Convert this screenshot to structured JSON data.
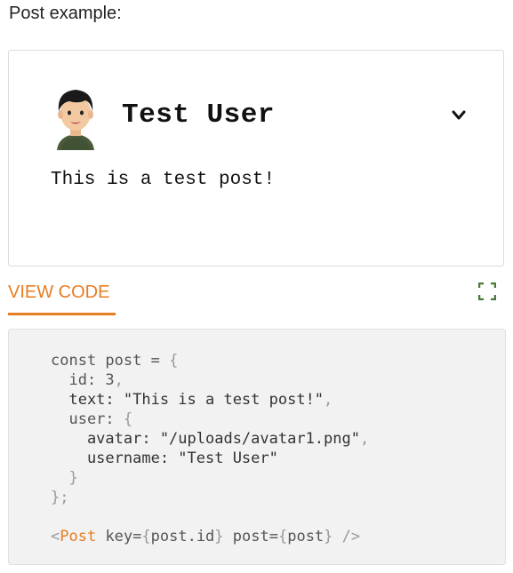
{
  "heading": "Post example:",
  "post": {
    "username": "Test User",
    "text": "This is a test post!",
    "avatar_icon": "avatar-boy-icon",
    "menu_icon": "chevron-down-icon"
  },
  "tabs": [
    {
      "label": "VIEW CODE",
      "active": true
    }
  ],
  "expand_icon": "fullscreen-icon",
  "code": {
    "lines": [
      [
        {
          "t": "const post = ",
          "c": "kw"
        },
        {
          "t": "{",
          "c": "punct"
        }
      ],
      [
        {
          "t": "  id: 3",
          "c": "kw"
        },
        {
          "t": ",",
          "c": "punct"
        }
      ],
      [
        {
          "t": "  text: \"This is a test post!\"",
          "c": "str"
        },
        {
          "t": ",",
          "c": "punct"
        }
      ],
      [
        {
          "t": "  user: ",
          "c": "kw"
        },
        {
          "t": "{",
          "c": "punct"
        }
      ],
      [
        {
          "t": "    avatar: \"/uploads/avatar1.png\"",
          "c": "str"
        },
        {
          "t": ",",
          "c": "punct"
        }
      ],
      [
        {
          "t": "    username: \"Test User\"",
          "c": "str"
        }
      ],
      [
        {
          "t": "  }",
          "c": "punct"
        }
      ],
      [
        {
          "t": "};",
          "c": "punct"
        }
      ],
      [
        {
          "t": "",
          "c": "kw"
        }
      ],
      [
        {
          "t": "<",
          "c": "punct"
        },
        {
          "t": "Post",
          "c": "tag"
        },
        {
          "t": " key=",
          "c": "attr"
        },
        {
          "t": "{",
          "c": "punct"
        },
        {
          "t": "post.id",
          "c": "attr"
        },
        {
          "t": "}",
          "c": "punct"
        },
        {
          "t": " post=",
          "c": "attr"
        },
        {
          "t": "{",
          "c": "punct"
        },
        {
          "t": "post",
          "c": "attr"
        },
        {
          "t": "}",
          "c": "punct"
        },
        {
          "t": " />",
          "c": "punct"
        }
      ]
    ]
  },
  "colors": {
    "accent": "#e67e22",
    "code_bg": "#f2f2f2",
    "card_border": "#dcdcdc"
  }
}
